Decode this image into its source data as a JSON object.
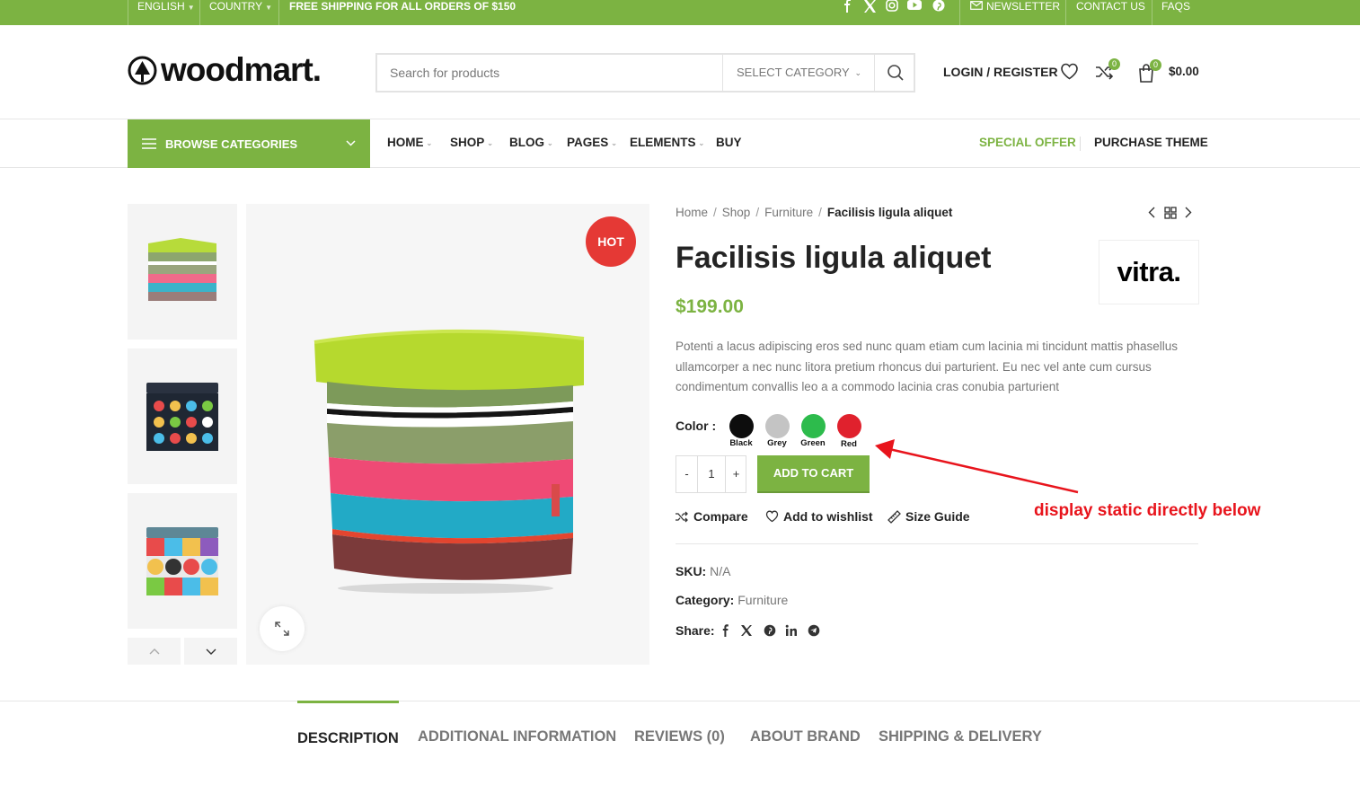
{
  "topbar": {
    "language": "ENGLISH",
    "country": "COUNTRY",
    "shipping": "FREE SHIPPING FOR ALL ORDERS OF $150",
    "newsletter": "NEWSLETTER",
    "contact": "CONTACT US",
    "faqs": "FAQS"
  },
  "header": {
    "logo": "woodmart.",
    "search_placeholder": "Search for products",
    "select_category": "SELECT CATEGORY",
    "login": "LOGIN / REGISTER",
    "compare_count": "0",
    "cart_count": "0",
    "cart_total": "$0.00"
  },
  "nav": {
    "browse": "BROWSE CATEGORIES",
    "items": [
      "HOME",
      "SHOP",
      "BLOG",
      "PAGES",
      "ELEMENTS",
      "BUY"
    ],
    "special_offer": "SPECIAL OFFER",
    "purchase": "PURCHASE THEME"
  },
  "product": {
    "breadcrumb": [
      "Home",
      "Shop",
      "Furniture",
      "Facilisis ligula aliquet"
    ],
    "badge": "HOT",
    "title": "Facilisis ligula aliquet",
    "brand": "vitra.",
    "price": "$199.00",
    "description": "Potenti a lacus adipiscing eros sed nunc quam etiam cum lacinia mi tincidunt mattis phasellus ullamcorper a nec nunc litora pretium rhoncus dui parturient. Eu nec vel ante cum cursus condimentum convallis leo a a commodo lacinia cras conubia parturient",
    "color_label": "Color :",
    "colors": [
      {
        "name": "Black",
        "hex": "#0d0d0d"
      },
      {
        "name": "Grey",
        "hex": "#c4c4c4"
      },
      {
        "name": "Green",
        "hex": "#2dbb4c"
      },
      {
        "name": "Red",
        "hex": "#e0212d"
      }
    ],
    "qty_minus": "-",
    "qty_value": "1",
    "qty_plus": "+",
    "add_to_cart": "ADD TO CART",
    "compare": "Compare",
    "wishlist": "Add to wishlist",
    "size_guide": "Size Guide",
    "sku_label": "SKU:",
    "sku_value": "N/A",
    "category_label": "Category:",
    "category_value": "Furniture",
    "share_label": "Share:"
  },
  "annotation": "display static directly below",
  "tabs": [
    "DESCRIPTION",
    "ADDITIONAL INFORMATION",
    "REVIEWS (0)",
    "ABOUT BRAND",
    "SHIPPING & DELIVERY"
  ],
  "accent": "#7cb342"
}
